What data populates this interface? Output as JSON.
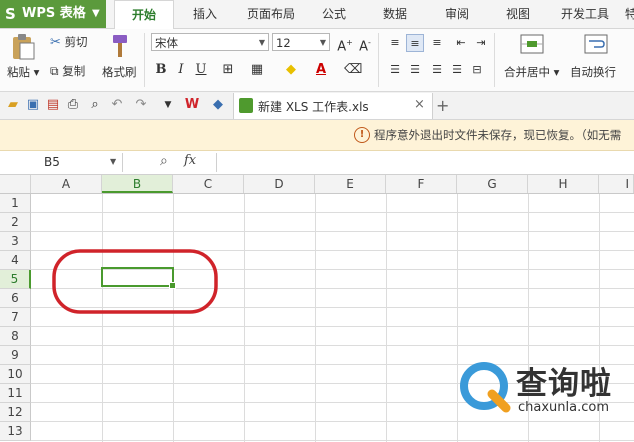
{
  "app": {
    "name": "WPS 表格",
    "logo": "S"
  },
  "tabs": [
    "开始",
    "插入",
    "页面布局",
    "公式",
    "数据",
    "审阅",
    "视图",
    "开发工具",
    "特"
  ],
  "active_tab": "开始",
  "ribbon": {
    "paste": "粘贴",
    "cut": "剪切",
    "copy": "复制",
    "format_painter": "格式刷",
    "font_name": "宋体",
    "font_size": "12",
    "bold": "B",
    "italic": "I",
    "underline": "U",
    "merge_center": "合并居中",
    "wrap_text": "自动换行"
  },
  "doc_tab": {
    "title": "新建 XLS 工作表.xls",
    "close": "×",
    "new": "+"
  },
  "notice": {
    "text": "程序意外退出时文件未保存，现已恢复。（如无需"
  },
  "formula_bar": {
    "cell_ref": "B5",
    "fx": "fx",
    "value": ""
  },
  "columns": [
    "A",
    "B",
    "C",
    "D",
    "E",
    "F",
    "G",
    "H",
    "I"
  ],
  "rows": [
    "1",
    "2",
    "3",
    "4",
    "5",
    "6",
    "7",
    "8",
    "9",
    "10",
    "11",
    "12",
    "13"
  ],
  "selected_cell": "B5",
  "watermark": {
    "brand": "查询啦",
    "url": "chaxunla.com"
  },
  "colors": {
    "accent_green": "#5b9a3c",
    "annotation_red": "#d0232a",
    "notice_bg": "#fef3d8"
  }
}
